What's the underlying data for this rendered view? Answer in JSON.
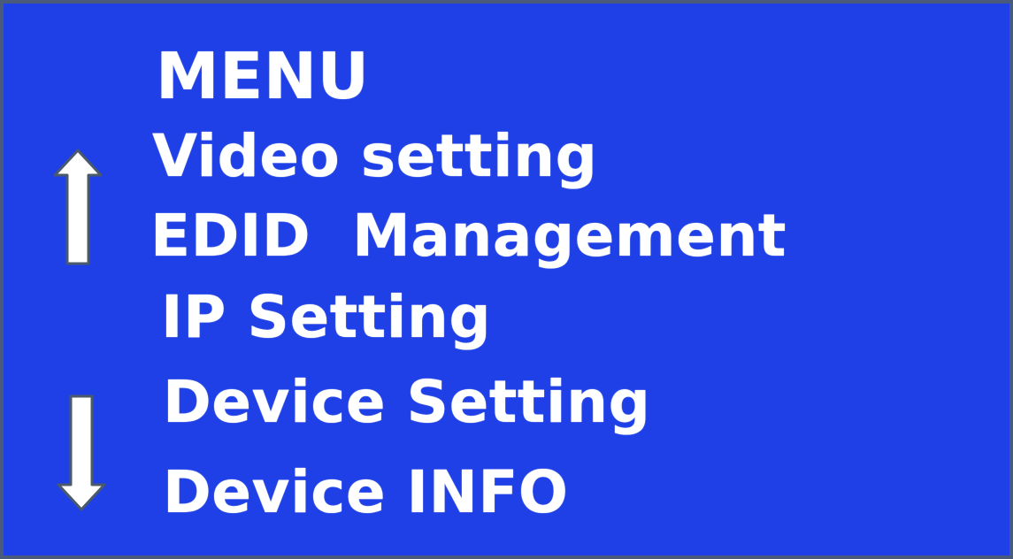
{
  "colors": {
    "background": "#1e40e6",
    "text": "#ffffff",
    "border": "#4a5a7a"
  },
  "menu": {
    "title": "MENU",
    "items": [
      "Video setting",
      "EDID  Management",
      "IP Setting",
      "Device Setting",
      "Device INFO"
    ]
  },
  "icons": {
    "scroll_up": "arrow-up-icon",
    "scroll_down": "arrow-down-icon"
  }
}
